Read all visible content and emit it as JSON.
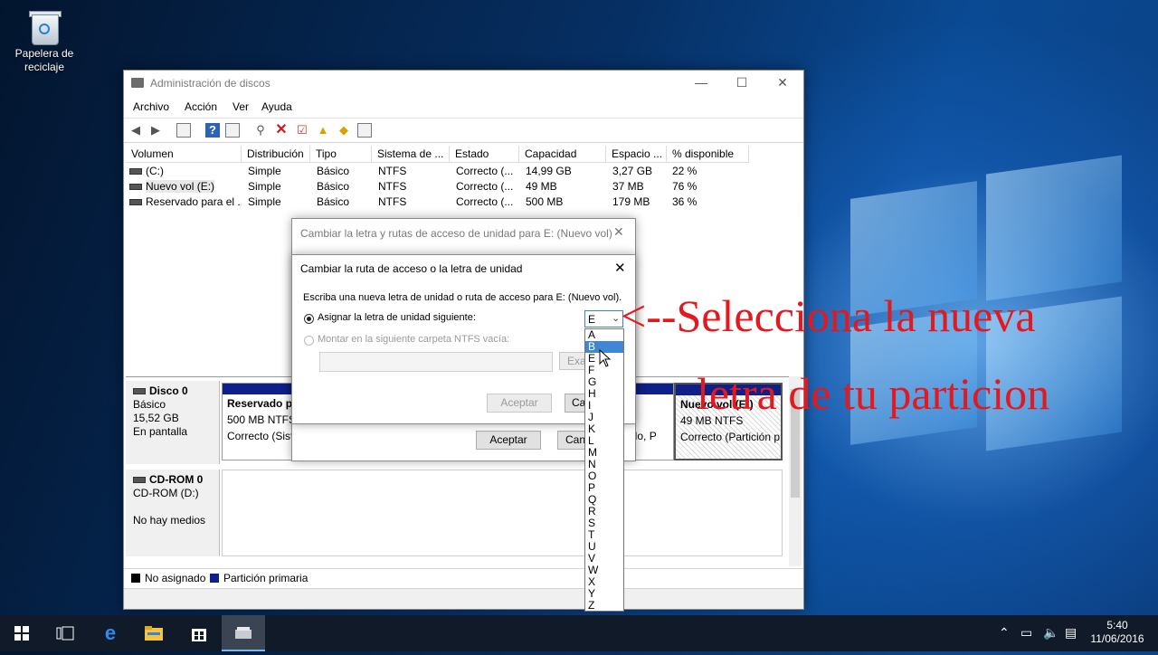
{
  "desktop": {
    "recycle_bin_label": "Papelera de reciclaje"
  },
  "window": {
    "title": "Administración de discos",
    "minimize_glyph": "—",
    "maximize_glyph": "☐",
    "close_glyph": "✕"
  },
  "menu": [
    "Archivo",
    "Acción",
    "Ver",
    "Ayuda"
  ],
  "toolbar_icons": [
    "back-icon",
    "forward-icon",
    "properties-icon",
    "help-icon",
    "view-icon",
    "connect-icon",
    "delete-icon",
    "check-icon",
    "folder-up-icon",
    "search-folder-icon",
    "list-icon"
  ],
  "volumes_table": {
    "columns": [
      "Volumen",
      "Distribución",
      "Tipo",
      "Sistema de ...",
      "Estado",
      "Capacidad",
      "Espacio ...",
      "% disponible"
    ],
    "rows": [
      [
        "(C:)",
        "Simple",
        "Básico",
        "NTFS",
        "Correcto (...",
        "14,99 GB",
        "3,27 GB",
        "22 %"
      ],
      [
        "Nuevo vol (E:)",
        "Simple",
        "Básico",
        "NTFS",
        "Correcto (...",
        "49 MB",
        "37 MB",
        "76 %"
      ],
      [
        "Reservado para el ...",
        "Simple",
        "Básico",
        "NTFS",
        "Correcto (...",
        "500 MB",
        "179 MB",
        "36 %"
      ]
    ]
  },
  "disks": {
    "disk0": {
      "name": "Disco 0",
      "type": "Básico",
      "size": "15,52 GB",
      "status": "En pantalla",
      "part1_name": "Reservado pa",
      "part1_size": "500 MB NTFS",
      "part1_status": "Correcto (Sist",
      "part2_status": "ado, P",
      "part3_name": "Nuevo vol (E:)",
      "part3_size": "49 MB NTFS",
      "part3_status": "Correcto (Partición p"
    },
    "cdrom": {
      "name": "CD-ROM 0",
      "drive": "CD-ROM (D:)",
      "status": "No hay medios"
    }
  },
  "legend": {
    "unallocated": "No asignado",
    "primary": "Partición primaria",
    "unallocated_color": "#000000",
    "primary_color": "#10208a"
  },
  "dialog_back": {
    "title": "Cambiar la letra y rutas de acceso de unidad para E: (Nuevo vol)",
    "ok": "Aceptar",
    "cancel": "Can"
  },
  "dialog_front": {
    "title": "Cambiar la ruta de acceso o la letra de unidad",
    "description": "Escriba una nueva letra de unidad o ruta de acceso para E: (Nuevo vol).",
    "option_assign": "Asignar la letra de unidad siguiente:",
    "option_mount": "Montar en la siguiente carpeta NTFS vacía:",
    "browse": "Exa",
    "ok": "Aceptar",
    "cancel": "Can",
    "selected_letter": "E",
    "letters": [
      "A",
      "B",
      "E",
      "F",
      "G",
      "H",
      "I",
      "J",
      "K",
      "L",
      "M",
      "N",
      "O",
      "P",
      "Q",
      "R",
      "S",
      "T",
      "U",
      "V",
      "W",
      "X",
      "Y",
      "Z"
    ],
    "highlighted": "B"
  },
  "annotation": {
    "line1": "<--Selecciona la  nueva",
    "line2": "letra de tu particion"
  },
  "taskbar": {
    "time": "5:40",
    "date": "11/06/2016"
  }
}
